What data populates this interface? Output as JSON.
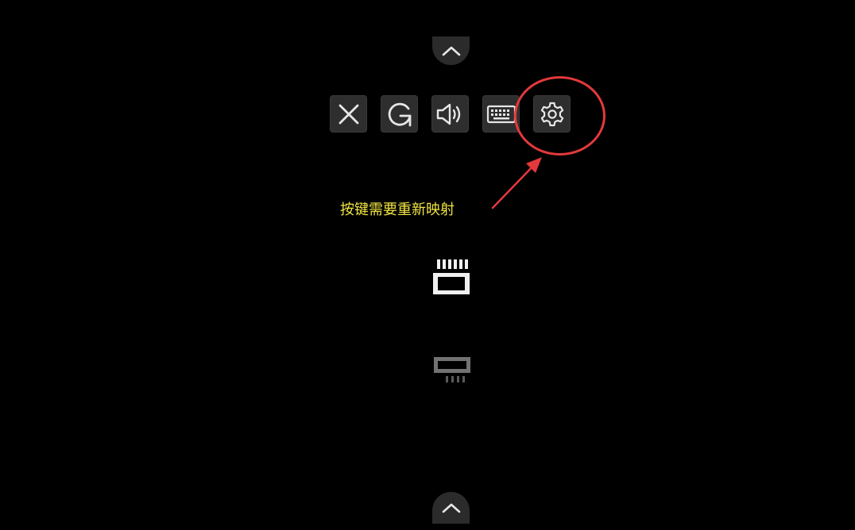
{
  "colors": {
    "background": "#000000",
    "button_bg": "#2e2e2e",
    "icon": "#e6e6e6",
    "annotation_red": "#e3393c",
    "annotation_text": "#f0e442"
  },
  "toolbar": {
    "buttons": [
      {
        "icon": "close-icon"
      },
      {
        "icon": "refresh-icon"
      },
      {
        "icon": "volume-icon"
      },
      {
        "icon": "keyboard-icon"
      },
      {
        "icon": "gear-icon"
      }
    ]
  },
  "annotation": {
    "text": "按键需要重新映射"
  },
  "icons": {
    "top_tab": "chevron-up-icon",
    "bottom_tab": "chevron-up-icon",
    "card_bright": "memory-card-icon",
    "card_dim": "memory-card-icon"
  }
}
